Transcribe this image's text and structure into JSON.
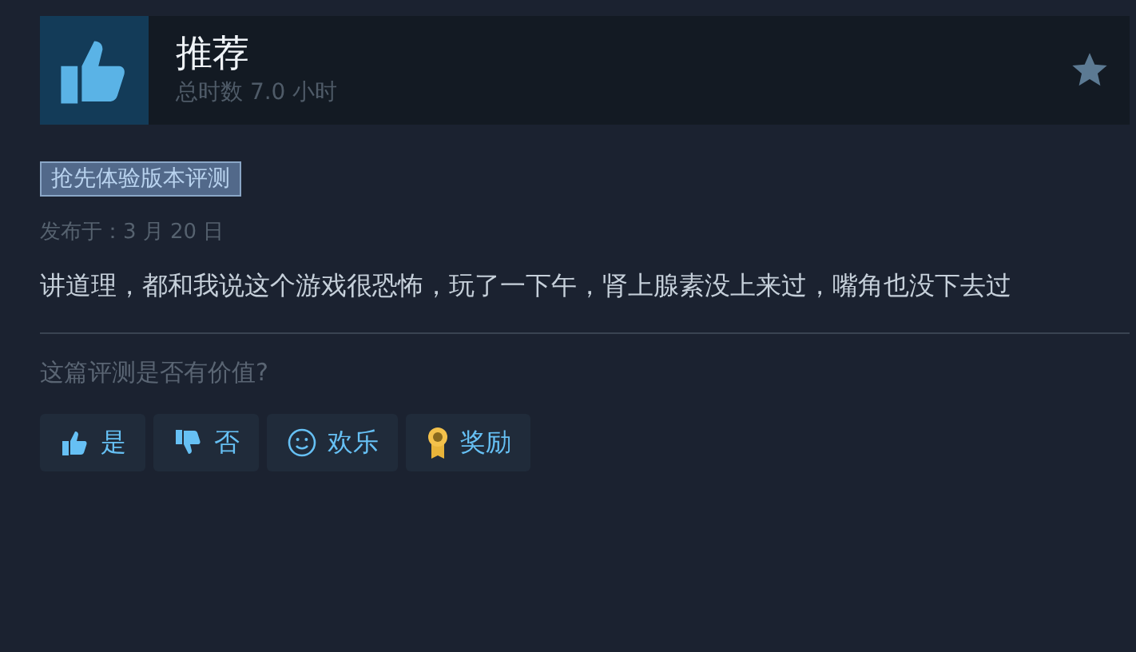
{
  "review": {
    "verdict": "推荐",
    "hours": "总时数 7.0 小时",
    "badge": "抢先体验版本评测",
    "posted": "发布于：3 月 20 日",
    "text": "讲道理，都和我说这个游戏很恐怖，玩了一下午，肾上腺素没上来过，嘴角也没下去过"
  },
  "helpful": {
    "question": "这篇评测是否有价值?",
    "buttons": [
      {
        "kind": "up",
        "label": "是"
      },
      {
        "kind": "down",
        "label": "否"
      },
      {
        "kind": "smile",
        "label": "欢乐"
      },
      {
        "kind": "award",
        "label": "奖励"
      }
    ]
  }
}
